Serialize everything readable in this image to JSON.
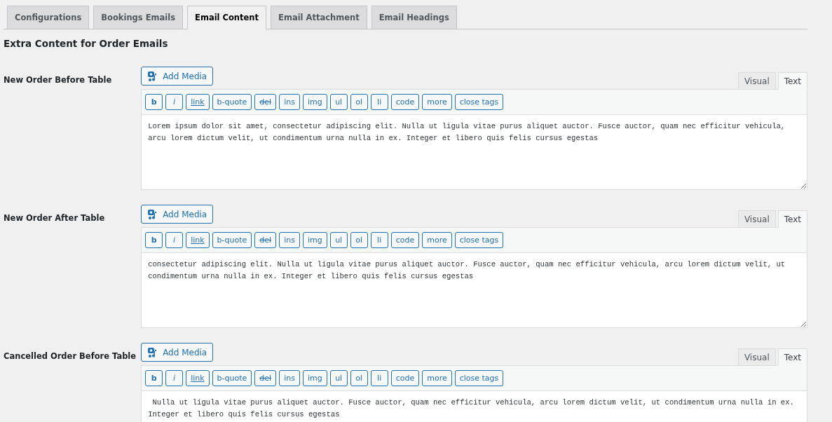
{
  "tabs": [
    {
      "label": "Configurations",
      "selected": false
    },
    {
      "label": "Bookings Emails",
      "selected": false
    },
    {
      "label": "Email Content",
      "selected": true
    },
    {
      "label": "Email Attachment",
      "selected": false
    },
    {
      "label": "Email Headings",
      "selected": false
    }
  ],
  "heading": "Extra Content for Order Emails",
  "fields": [
    {
      "label": "New Order Before Table",
      "add_media": "Add Media",
      "editor_tabs": [
        {
          "label": "Visual",
          "selected": false
        },
        {
          "label": "Text",
          "selected": true
        }
      ],
      "quicktags": [
        {
          "label": "b",
          "kind": "bold"
        },
        {
          "label": "i",
          "kind": "italic"
        },
        {
          "label": "link",
          "kind": "link"
        },
        {
          "label": "b-quote",
          "kind": "plain"
        },
        {
          "label": "del",
          "kind": "strike"
        },
        {
          "label": "ins",
          "kind": "plain"
        },
        {
          "label": "img",
          "kind": "plain"
        },
        {
          "label": "ul",
          "kind": "plain"
        },
        {
          "label": "ol",
          "kind": "plain"
        },
        {
          "label": "li",
          "kind": "plain"
        },
        {
          "label": "code",
          "kind": "plain"
        },
        {
          "label": "more",
          "kind": "plain"
        },
        {
          "label": "close tags",
          "kind": "plain"
        }
      ],
      "content": "Lorem ipsum dolor sit amet, consectetur adipiscing elit. Nulla ut ligula vitae purus aliquet auctor. Fusce auctor, quam nec efficitur vehicula, arcu lorem dictum velit, ut condimentum urna nulla in ex. Integer et libero quis felis cursus egestas"
    },
    {
      "label": "New Order After Table",
      "add_media": "Add Media",
      "editor_tabs": [
        {
          "label": "Visual",
          "selected": false
        },
        {
          "label": "Text",
          "selected": true
        }
      ],
      "quicktags": [
        {
          "label": "b",
          "kind": "bold"
        },
        {
          "label": "i",
          "kind": "italic"
        },
        {
          "label": "link",
          "kind": "link"
        },
        {
          "label": "b-quote",
          "kind": "plain"
        },
        {
          "label": "del",
          "kind": "strike"
        },
        {
          "label": "ins",
          "kind": "plain"
        },
        {
          "label": "img",
          "kind": "plain"
        },
        {
          "label": "ul",
          "kind": "plain"
        },
        {
          "label": "ol",
          "kind": "plain"
        },
        {
          "label": "li",
          "kind": "plain"
        },
        {
          "label": "code",
          "kind": "plain"
        },
        {
          "label": "more",
          "kind": "plain"
        },
        {
          "label": "close tags",
          "kind": "plain"
        }
      ],
      "content": "consectetur adipiscing elit. Nulla ut ligula vitae purus aliquet auctor. Fusce auctor, quam nec efficitur vehicula, arcu lorem dictum velit, ut condimentum urna nulla in ex. Integer et libero quis felis cursus egestas"
    },
    {
      "label": "Cancelled Order Before Table",
      "add_media": "Add Media",
      "editor_tabs": [
        {
          "label": "Visual",
          "selected": false
        },
        {
          "label": "Text",
          "selected": true
        }
      ],
      "quicktags": [
        {
          "label": "b",
          "kind": "bold"
        },
        {
          "label": "i",
          "kind": "italic"
        },
        {
          "label": "link",
          "kind": "link"
        },
        {
          "label": "b-quote",
          "kind": "plain"
        },
        {
          "label": "del",
          "kind": "strike"
        },
        {
          "label": "ins",
          "kind": "plain"
        },
        {
          "label": "img",
          "kind": "plain"
        },
        {
          "label": "ul",
          "kind": "plain"
        },
        {
          "label": "ol",
          "kind": "plain"
        },
        {
          "label": "li",
          "kind": "plain"
        },
        {
          "label": "code",
          "kind": "plain"
        },
        {
          "label": "more",
          "kind": "plain"
        },
        {
          "label": "close tags",
          "kind": "plain"
        }
      ],
      "content": " Nulla ut ligula vitae purus aliquet auctor. Fusce auctor, quam nec efficitur vehicula, arcu lorem dictum velit, ut condimentum urna nulla in ex. Integer et libero quis felis cursus egestas"
    }
  ]
}
